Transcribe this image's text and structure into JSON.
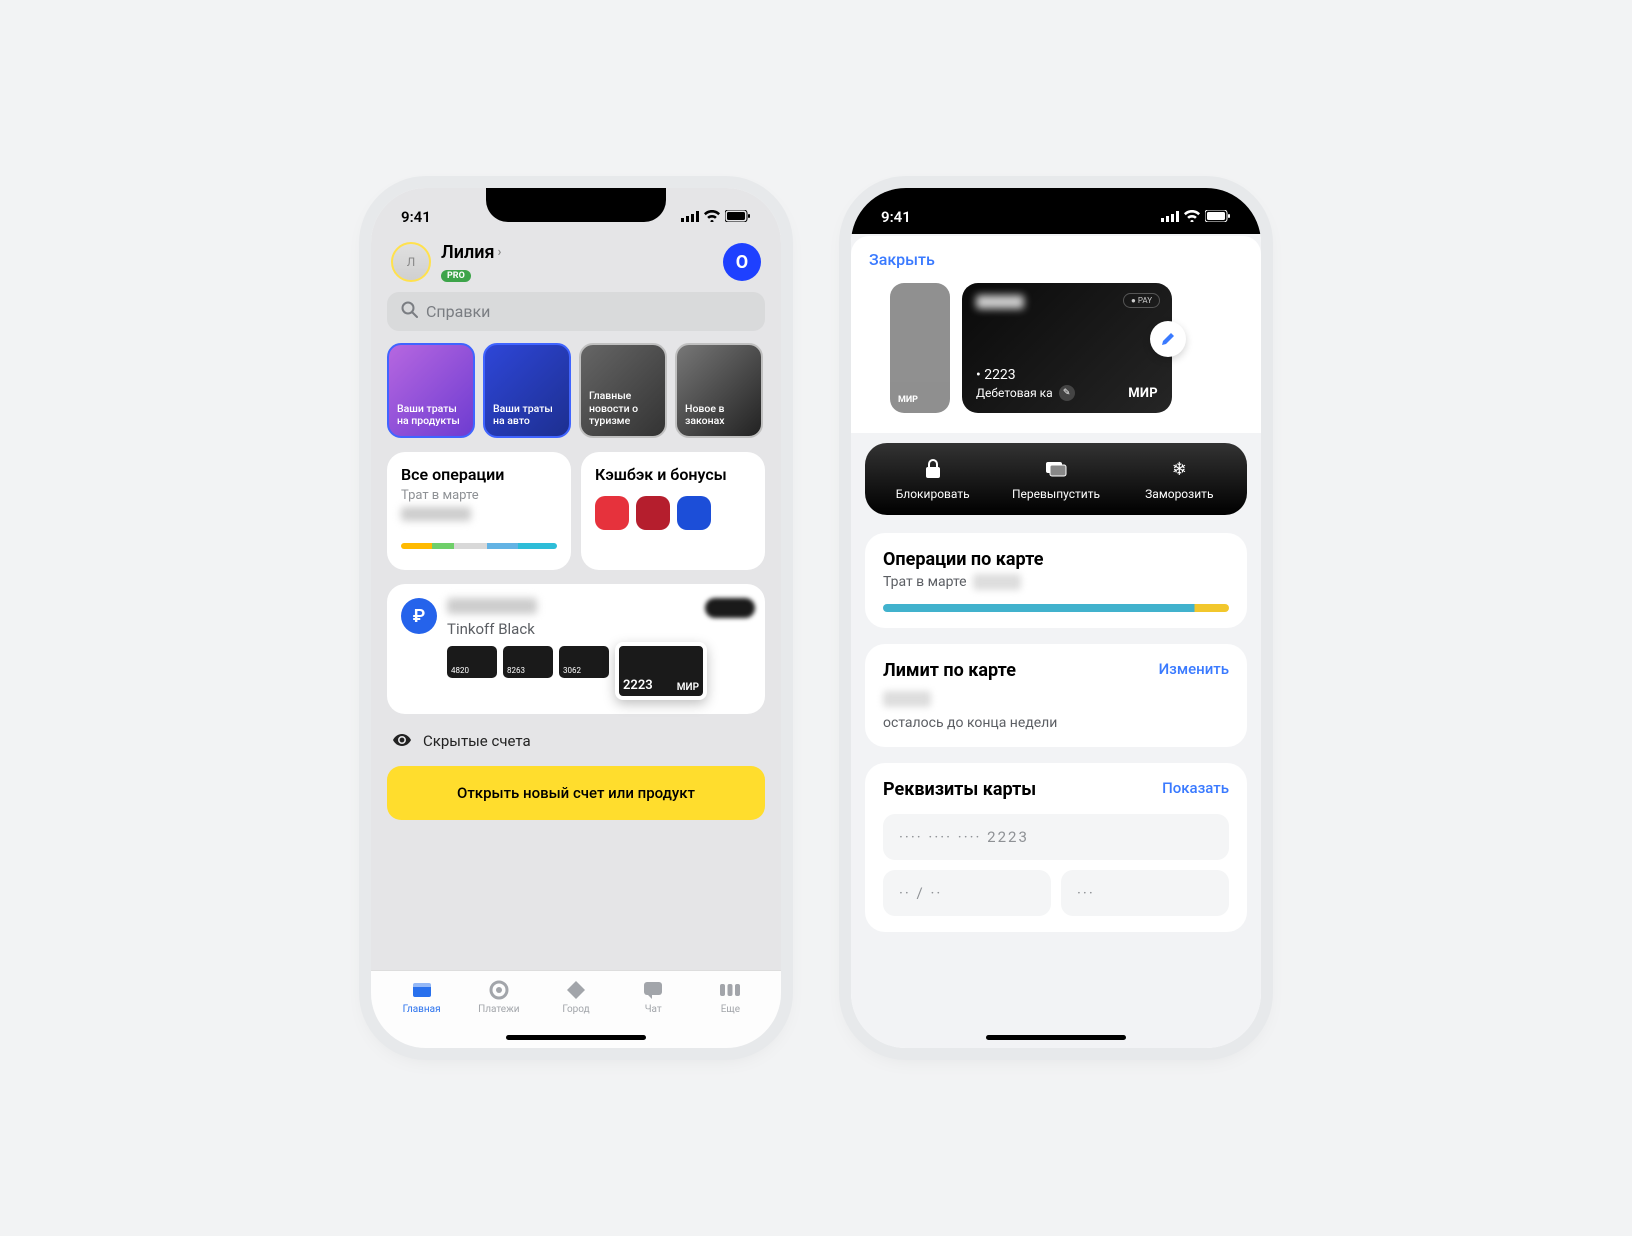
{
  "status": {
    "time": "9:41"
  },
  "home": {
    "user_name": "Лилия",
    "pro_badge": "PRO",
    "avatar_letter": "Л",
    "o_logo": "O",
    "search_placeholder": "Справки",
    "stories": [
      "Ваши траты на продукты",
      "Ваши траты на авто",
      "Главные новости о туризме",
      "Новое в законах"
    ],
    "ops_widget": {
      "title": "Все операции",
      "sub": "Трат в марте"
    },
    "cashback_widget": {
      "title": "Кэшбэк и бонусы"
    },
    "account": {
      "name": "Tinkoff Black",
      "mini_cards": [
        "4820",
        "8263",
        "3062"
      ],
      "selected_card": "2223",
      "mir_label": "МИР"
    },
    "hidden_accounts": "Скрытые счета",
    "open_button": "Открыть новый счет или продукт",
    "tabs": [
      "Главная",
      "Платежи",
      "Город",
      "Чат",
      "Еще"
    ]
  },
  "detail": {
    "close": "Закрыть",
    "big_card": {
      "pay_label": "● PAY",
      "last4": "• 2223",
      "type": "Дебетовая ка",
      "mir": "МИР"
    },
    "ghost_mir": "МИР",
    "actions": {
      "block": "Блокировать",
      "reissue": "Перевыпустить",
      "freeze": "Заморозить"
    },
    "ops": {
      "title": "Операции по карте",
      "sub": "Трат в марте"
    },
    "limit": {
      "title": "Лимит по карте",
      "change": "Изменить",
      "remaining": "осталось до конца недели"
    },
    "requisites": {
      "title": "Реквизиты карты",
      "show": "Показать",
      "number": "····  ····  ····  2223",
      "exp": "·· / ··",
      "cvv": "···"
    }
  }
}
